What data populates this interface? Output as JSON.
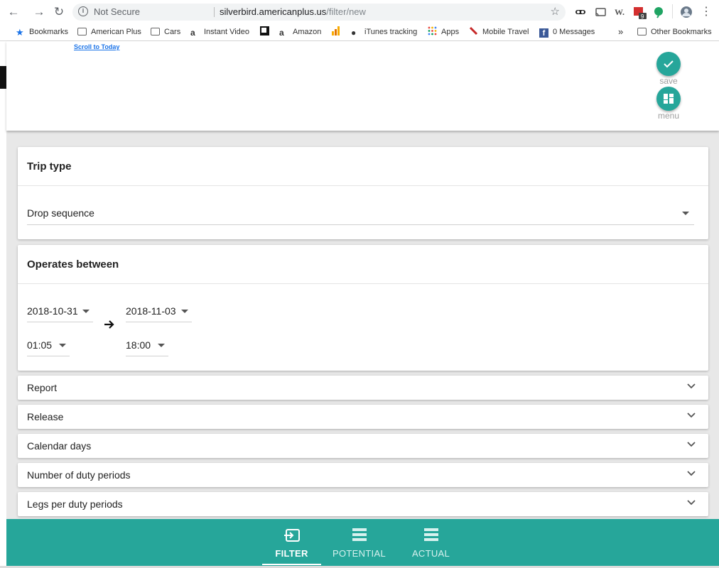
{
  "browser": {
    "not_secure": "Not Secure",
    "url_host": "silverbird.americanplus.us",
    "url_path": "/filter/new",
    "bookmarks": [
      {
        "label": "Bookmarks",
        "icon": "star-icon"
      },
      {
        "label": "American Plus",
        "icon": "folder-icon"
      },
      {
        "label": "Cars",
        "icon": "folder-icon"
      },
      {
        "label": "Instant Video",
        "icon": "amazon-icon"
      },
      {
        "label": "",
        "icon": "flipboard-icon"
      },
      {
        "label": "Amazon",
        "icon": "amazon-icon"
      },
      {
        "label": "",
        "icon": "analytics-icon"
      },
      {
        "label": "iTunes tracking",
        "icon": "apple-icon"
      },
      {
        "label": "Apps",
        "icon": "apps-grid-icon"
      },
      {
        "label": "Mobile Travel",
        "icon": "feather-icon"
      },
      {
        "label": "0 Messages",
        "icon": "facebook-icon"
      }
    ],
    "overflow": "»",
    "other_bookmarks": "Other Bookmarks",
    "ext_badge": "9"
  },
  "header": {
    "scroll_link": "Scroll to Today",
    "save_label": "save",
    "menu_label": "menu"
  },
  "trip_type": {
    "title": "Trip type",
    "value": "Drop sequence"
  },
  "operates_between": {
    "title": "Operates between",
    "start_date": "2018-10-31",
    "end_date": "2018-11-03",
    "start_time": "01:05",
    "end_time": "18:00"
  },
  "sections": [
    "Report",
    "Release",
    "Calendar days",
    "Number of duty periods",
    "Legs per duty periods"
  ],
  "bottom_nav": {
    "tabs": [
      {
        "label": "FILTER",
        "icon": "filter-login-icon",
        "active": true
      },
      {
        "label": "POTENTIAL",
        "icon": "list-icon",
        "active": false
      },
      {
        "label": "ACTUAL",
        "icon": "list-icon",
        "active": false
      }
    ]
  },
  "colors": {
    "accent": "#26a69a",
    "link": "#1a73e8"
  }
}
